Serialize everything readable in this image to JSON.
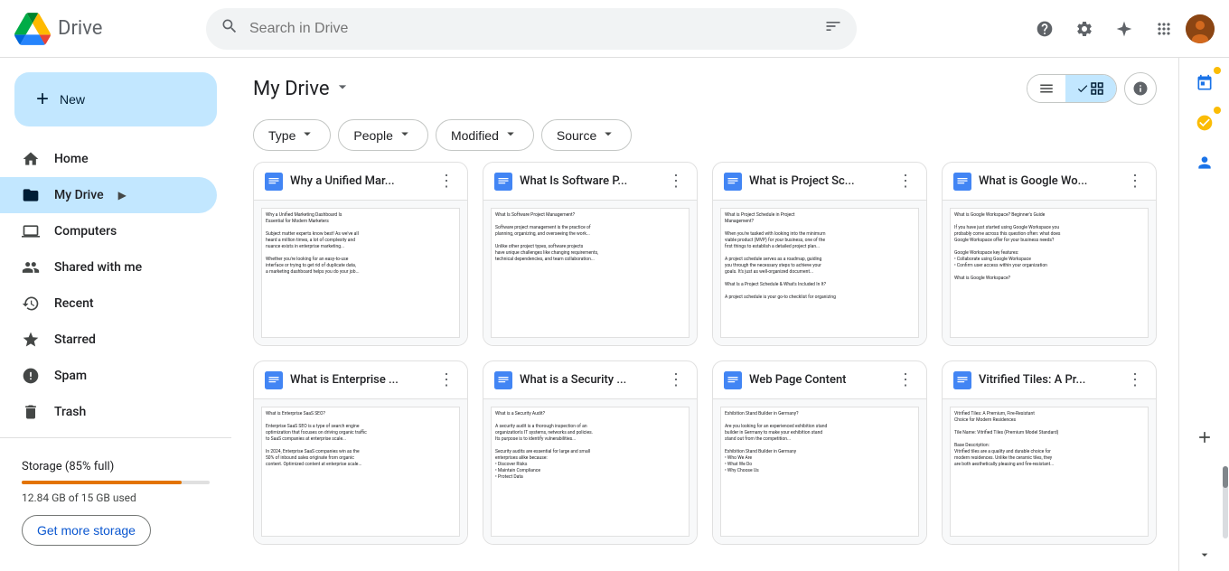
{
  "app": {
    "name": "Drive",
    "logo_alt": "Google Drive"
  },
  "topbar": {
    "search_placeholder": "Search in Drive",
    "icons": {
      "search": "🔍",
      "filter": "⚙",
      "support": "?",
      "settings": "⚙",
      "gemini": "✦",
      "apps": "⠿"
    }
  },
  "sidebar": {
    "new_button_label": "New",
    "nav_items": [
      {
        "id": "home",
        "label": "Home",
        "icon": "🏠",
        "active": false
      },
      {
        "id": "my-drive",
        "label": "My Drive",
        "icon": "📁",
        "active": true
      },
      {
        "id": "computers",
        "label": "Computers",
        "icon": "💻",
        "active": false
      },
      {
        "id": "shared-with-me",
        "label": "Shared with me",
        "icon": "👤",
        "active": false
      },
      {
        "id": "recent",
        "label": "Recent",
        "icon": "🕐",
        "active": false
      },
      {
        "id": "starred",
        "label": "Starred",
        "icon": "⭐",
        "active": false
      },
      {
        "id": "spam",
        "label": "Spam",
        "icon": "🚫",
        "active": false
      },
      {
        "id": "trash",
        "label": "Trash",
        "icon": "🗑",
        "active": false
      }
    ],
    "storage": {
      "label": "Storage (85% full)",
      "used_text": "12.84 GB of 15 GB used",
      "fill_percent": 85,
      "get_more_label": "Get more storage"
    }
  },
  "content": {
    "breadcrumb": "My Drive",
    "filters": [
      {
        "id": "type",
        "label": "Type"
      },
      {
        "id": "people",
        "label": "People"
      },
      {
        "id": "modified",
        "label": "Modified"
      },
      {
        "id": "source",
        "label": "Source"
      }
    ],
    "files": [
      {
        "id": 1,
        "title": "Why a Unified Mar...",
        "full_title": "Why a Unified Marketing Dashboard Is Essential for Modern Marketers",
        "preview_lines": [
          "Why a Unified Marketing Dashboard Is",
          "Essential for Modern Marketers",
          "",
          "Subject matter experts know best! As we've all",
          "heard a million times, a lot of complexity and",
          "nuance exists in enterprise marketing...",
          "",
          "Whether you're looking for an easy-to-use",
          "interface or trying to get rid of duplicate data,",
          "a marketing dashboard helps you do your job..."
        ]
      },
      {
        "id": 2,
        "title": "What Is Software P...",
        "full_title": "What Is Software Project Management?",
        "preview_lines": [
          "What Is Software Project Management?",
          "",
          "Software project management is the practice of",
          "planning, organizing, and overseeing the work...",
          "",
          "Unlike other project types, software projects",
          "have unique challenges like changing requirements,",
          "technical dependencies, and team collaboration..."
        ]
      },
      {
        "id": 3,
        "title": "What is Project Sc...",
        "full_title": "What is Project Schedule in Project Management?",
        "preview_lines": [
          "What is Project Schedule in Project",
          "Management?",
          "",
          "When you're tasked with looking into the minimum",
          "viable product (MVP) for your business, one of the",
          "first things to establish a detailed project plan...",
          "",
          "A project schedule serves as a roadmap, guiding",
          "you through the necessary steps to achieve your",
          "goals. It's just as well-organized document...",
          "",
          "What Is a Project Schedule & What's Included In It?",
          "",
          "A project schedule is your go-to checklist for organizing"
        ]
      },
      {
        "id": 4,
        "title": "What is Google Wo...",
        "full_title": "What is Google Workspace? Beginner's Guide",
        "preview_lines": [
          "What is Google Workspace? Beginner's Guide",
          "",
          "If you have just started using Google Workspace you",
          "probably come across this question often: what does",
          "Google Workspace offer for your business needs?",
          "",
          "Google Workspace key features:",
          "• Collaborate using Google Workspace",
          "• Confirm user access within your organization",
          "",
          "What is Google Workspace?"
        ]
      },
      {
        "id": 5,
        "title": "What is Enterprise ...",
        "full_title": "What is Enterprise SaaS SEO?",
        "preview_lines": [
          "What is Enterprise SaaS SEO?",
          "",
          "Enterprise SaaS SEO is a type of search engine",
          "optimization that focuses on driving organic traffic",
          "to SaaS companies at enterprise scale...",
          "",
          "In 2024, Enterprise SaaS companies win as the",
          "50% of inbound sales originate from organic",
          "content. Optimized content at enterprise scale..."
        ]
      },
      {
        "id": 6,
        "title": "What is a Security ...",
        "full_title": "What is a Security Audit?",
        "preview_lines": [
          "What is a Security Audit?",
          "",
          "A security audit is a thorough inspection of an",
          "organization's IT systems, networks and policies.",
          "Its purpose is to identify vulnerabilities...",
          "",
          "Security audits are essential for large and small",
          "enterprises alike because:",
          "• Discover Risks",
          "• Maintain Compliance",
          "• Protect Data"
        ]
      },
      {
        "id": 7,
        "title": "Web Page Content",
        "full_title": "Web Page Content - Exhibition Stand Builder in Germany?",
        "preview_lines": [
          "Exhibition Stand Builder in Germany?",
          "",
          "Are you looking for an experienced exhibition stand",
          "builder in Germany to make your exhibition stand",
          "stand out from the competition...",
          "",
          "Exhibition Stand Builder in Germany",
          "• Who We Are",
          "• What We Do",
          "• Why Choose Us"
        ]
      },
      {
        "id": 8,
        "title": "Vitrified Tiles: A Pr...",
        "full_title": "Vitrified Tiles: A Premium, Fire-Resistant Choice for Modern Residences",
        "preview_lines": [
          "Vitrified Tiles: A Premium, Fire-Resistant",
          "Choice for Modern Residences",
          "",
          "Tile Name: Vitrified Tiles (Premium Model Standard)",
          "",
          "Base Description:",
          "Vitrified tiles are a quality and durable choice for",
          "modern residences. Unlike the ceramic tiles, they",
          "are both aesthetically pleasing and fire-resistant..."
        ]
      }
    ]
  },
  "view": {
    "list_icon": "≡",
    "grid_icon": "⊞",
    "active": "grid",
    "info_icon": "ℹ"
  }
}
